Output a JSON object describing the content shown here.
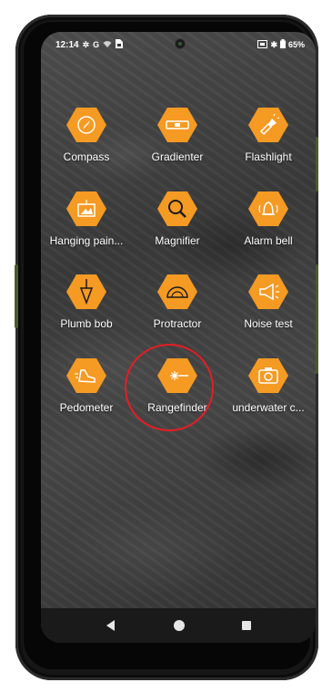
{
  "status_bar": {
    "time": "12:14",
    "battery": "65%",
    "icons": [
      "settings-icon",
      "google-icon",
      "wifi-icon",
      "sim-icon",
      "cast-icon",
      "bluetooth-icon",
      "battery-icon"
    ]
  },
  "apps": [
    {
      "label": "Compass",
      "icon": "compass-icon"
    },
    {
      "label": "Gradienter",
      "icon": "level-icon"
    },
    {
      "label": "Flashlight",
      "icon": "flashlight-icon"
    },
    {
      "label": "Hanging pain...",
      "icon": "picture-frame-icon"
    },
    {
      "label": "Magnifier",
      "icon": "magnifier-icon"
    },
    {
      "label": "Alarm bell",
      "icon": "alarm-bell-icon"
    },
    {
      "label": "Plumb bob",
      "icon": "plumb-bob-icon"
    },
    {
      "label": "Protractor",
      "icon": "protractor-icon"
    },
    {
      "label": "Noise test",
      "icon": "megaphone-icon"
    },
    {
      "label": "Pedometer",
      "icon": "shoe-icon"
    },
    {
      "label": "Rangefinder",
      "icon": "laser-icon"
    },
    {
      "label": "underwater c...",
      "icon": "camera-icon"
    }
  ],
  "colors": {
    "accent": "#f59a23",
    "icon_stroke": "#ffffff",
    "highlight": "#e41e25"
  },
  "nav": {
    "back": "back-icon",
    "home": "home-icon",
    "recents": "recents-icon"
  }
}
